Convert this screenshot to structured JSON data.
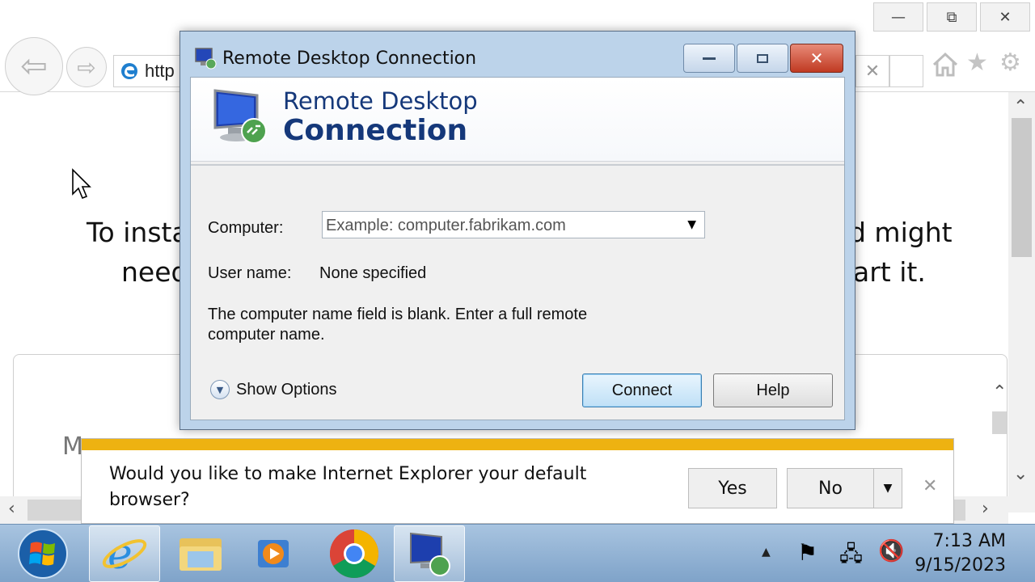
{
  "browser": {
    "address_text": "http",
    "window_controls": {
      "minimize": "—",
      "restore": "⧉",
      "close": "✕"
    },
    "tab_close": "✕"
  },
  "page": {
    "line1_left": "To insta",
    "line1_right": "d might",
    "line2_left": "need",
    "line2_right": "art it.",
    "card_letter": "M"
  },
  "rdp_dialog": {
    "window_title": "Remote Desktop Connection",
    "banner_line1": "Remote Desktop",
    "banner_line2": "Connection",
    "computer_label": "Computer:",
    "computer_placeholder": "Example: computer.fabrikam.com",
    "username_label": "User name:",
    "username_value": "None specified",
    "message": "The computer name field is blank. Enter a full remote computer name.",
    "show_options_label": "Show Options",
    "connect_label": "Connect",
    "help_label": "Help"
  },
  "notification": {
    "message": "Would you like to make Internet Explorer your default browser?",
    "yes_label": "Yes",
    "no_label": "No"
  },
  "taskbar": {
    "time": "7:13 AM",
    "date": "9/15/2023",
    "pinned": [
      "start-button",
      "internet-explorer",
      "file-explorer",
      "media-player",
      "chrome",
      "remote-desktop"
    ]
  },
  "colors": {
    "notify_stripe": "#eeb211",
    "banner_text": "#15387a",
    "close_button": "#c7412f"
  }
}
